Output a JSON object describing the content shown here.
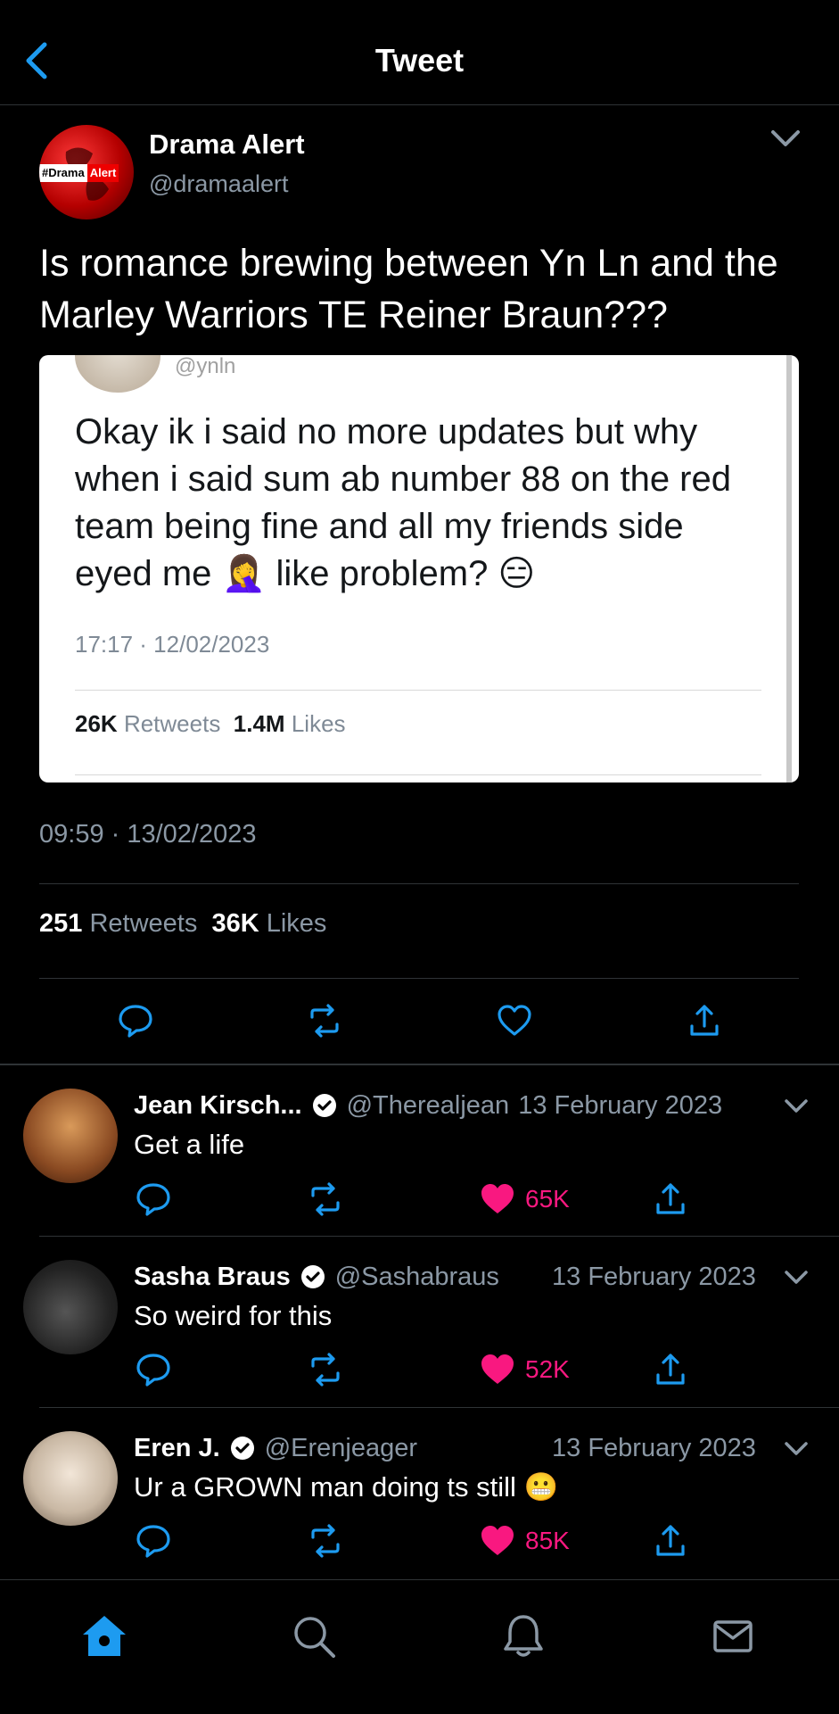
{
  "header": {
    "title": "Tweet"
  },
  "main_tweet": {
    "avatar_badge": {
      "left": "#Drama",
      "right": "Alert"
    },
    "author_name": "Drama Alert",
    "author_handle": "@dramaalert",
    "text": "Is romance brewing between Yn Ln and the Marley Warriors TE Reiner Braun???",
    "quote": {
      "handle": "@ynln",
      "text": "Okay ik i said no more updates but why when i said sum ab number 88 on the red team being fine and all my friends side eyed me 🤦‍♀️ like problem? 😑",
      "time": "17:17 · 12/02/2023",
      "retweets_count": "26K",
      "retweets_label": "Retweets",
      "likes_count": "1.4M",
      "likes_label": "Likes"
    },
    "time": "09:59 · 13/02/2023",
    "retweets_count": "251",
    "retweets_label": "Retweets",
    "likes_count": "36K",
    "likes_label": "Likes"
  },
  "replies": [
    {
      "name": "Jean Kirsch...",
      "handle": "@Therealjean",
      "date": "13 February 2023",
      "text": "Get a life",
      "likes": "65K"
    },
    {
      "name": "Sasha Braus",
      "handle": "@Sashabraus",
      "date": "13 February 2023",
      "text": "So weird for this",
      "likes": "52K"
    },
    {
      "name": "Eren J.",
      "handle": "@Erenjeager",
      "date": "13 February 2023",
      "text": "Ur a GROWN man doing ts still 😬",
      "likes": "85K"
    }
  ],
  "icons": {
    "back": "chevron-left-icon",
    "more": "chevron-down-icon",
    "reply": "reply-icon",
    "retweet": "retweet-icon",
    "like": "heart-icon",
    "share": "share-icon",
    "home": "home-icon",
    "search": "search-icon",
    "notifications": "bell-icon",
    "messages": "mail-icon"
  },
  "colors": {
    "accent": "#1d9bf0",
    "like": "#f91880",
    "muted": "#8b98a5",
    "background": "#000000"
  }
}
